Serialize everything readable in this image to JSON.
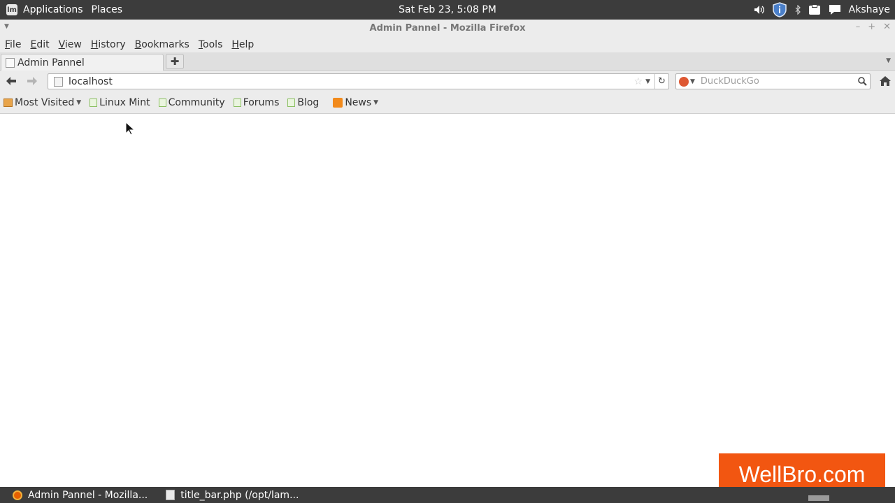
{
  "top_panel": {
    "menus": [
      "Applications",
      "Places"
    ],
    "clock": "Sat Feb 23,  5:08 PM",
    "user": "Akshaye"
  },
  "window": {
    "title": "Admin Pannel - Mozilla Firefox"
  },
  "menubar": {
    "items": [
      {
        "first": "F",
        "rest": "ile"
      },
      {
        "first": "E",
        "rest": "dit"
      },
      {
        "first": "V",
        "rest": "iew"
      },
      {
        "first": "H",
        "rest": "istory"
      },
      {
        "first": "B",
        "rest": "ookmarks"
      },
      {
        "first": "T",
        "rest": "ools"
      },
      {
        "first": "H",
        "rest": "elp"
      }
    ]
  },
  "tabs": {
    "active_label": "Admin Pannel"
  },
  "navbar": {
    "url": "localhost",
    "search_placeholder": "DuckDuckGo"
  },
  "bookmarks": {
    "most_visited": "Most Visited",
    "items": [
      "Linux Mint",
      "Community",
      "Forums",
      "Blog"
    ],
    "news": "News"
  },
  "watermark": "WellBro.com",
  "taskbar": {
    "tasks": [
      "Admin Pannel - Mozilla...",
      "title_bar.php (/opt/lam..."
    ]
  },
  "colors": {
    "panel": "#3c3c3c",
    "chrome": "#ececec",
    "watermark": "#f25611"
  }
}
